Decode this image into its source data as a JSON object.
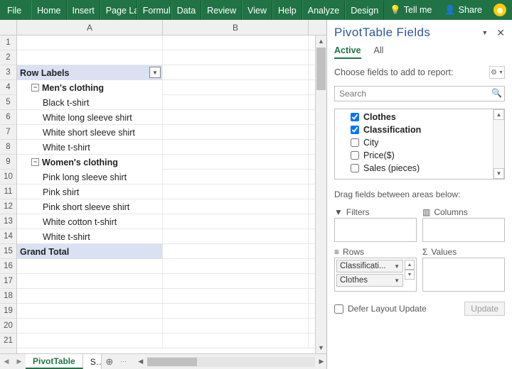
{
  "ribbon": {
    "tabs": [
      "File",
      "Home",
      "Insert",
      "Page La",
      "Formul",
      "Data",
      "Review",
      "View",
      "Help",
      "Analyze",
      "Design"
    ],
    "tellme_placeholder": "Tell me",
    "share_label": "Share"
  },
  "grid": {
    "columns": [
      "A",
      "B"
    ],
    "row_count": 21,
    "rows": [
      {
        "r": 3,
        "type": "header",
        "label": "Row Labels",
        "has_filter": true
      },
      {
        "r": 4,
        "type": "group",
        "label": "Men's clothing"
      },
      {
        "r": 5,
        "type": "item",
        "label": "Black t-shirt"
      },
      {
        "r": 6,
        "type": "item",
        "label": "White long sleeve shirt"
      },
      {
        "r": 7,
        "type": "item",
        "label": "White short sleeve shirt"
      },
      {
        "r": 8,
        "type": "item",
        "label": "White t-shirt"
      },
      {
        "r": 9,
        "type": "group",
        "label": "Women's clothing"
      },
      {
        "r": 10,
        "type": "item",
        "label": "Pink long sleeve shirt"
      },
      {
        "r": 11,
        "type": "item",
        "label": "Pink shirt"
      },
      {
        "r": 12,
        "type": "item",
        "label": "Pink short sleeve shirt"
      },
      {
        "r": 13,
        "type": "item",
        "label": "White cotton t-shirt"
      },
      {
        "r": 14,
        "type": "item",
        "label": "White t-shirt"
      },
      {
        "r": 15,
        "type": "total",
        "label": "Grand Total"
      }
    ]
  },
  "sheets": {
    "active": "PivotTable",
    "tabs": [
      "PivotTable",
      "S…"
    ]
  },
  "fields_pane": {
    "title": "PivotTable Fields",
    "tabs": {
      "active": "Active",
      "all": "All"
    },
    "choose_label": "Choose fields to add to report:",
    "search_placeholder": "Search",
    "fields": [
      {
        "name": "Clothes",
        "checked": true
      },
      {
        "name": "Classification",
        "checked": true
      },
      {
        "name": "City",
        "checked": false
      },
      {
        "name": "Price($)",
        "checked": false
      },
      {
        "name": "Sales (pieces)",
        "checked": false
      }
    ],
    "drag_label": "Drag fields between areas below:",
    "areas": {
      "filters": {
        "title": "Filters",
        "items": []
      },
      "columns": {
        "title": "Columns",
        "items": []
      },
      "rows": {
        "title": "Rows",
        "items": [
          "Classificati...",
          "Clothes"
        ]
      },
      "values": {
        "title": "Values",
        "items": []
      }
    },
    "defer_label": "Defer Layout Update",
    "update_label": "Update"
  }
}
